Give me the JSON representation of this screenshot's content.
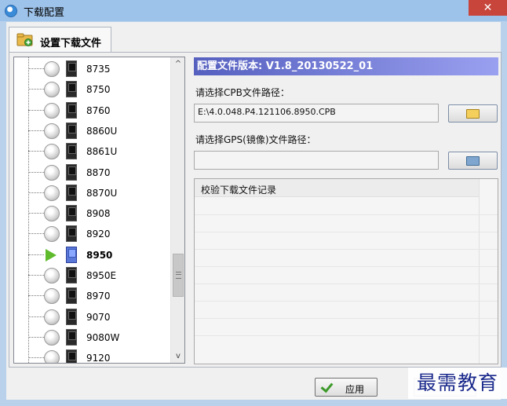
{
  "window": {
    "title": "下载配置",
    "close_glyph": "✕"
  },
  "tab": {
    "label": "设置下载文件",
    "icon": "folder-add-icon"
  },
  "tree": {
    "items": [
      {
        "label": "8735",
        "state": "idle"
      },
      {
        "label": "8750",
        "state": "idle"
      },
      {
        "label": "8760",
        "state": "idle"
      },
      {
        "label": "8860U",
        "state": "idle"
      },
      {
        "label": "8861U",
        "state": "idle"
      },
      {
        "label": "8870",
        "state": "idle"
      },
      {
        "label": "8870U",
        "state": "idle"
      },
      {
        "label": "8908",
        "state": "idle"
      },
      {
        "label": "8920",
        "state": "idle"
      },
      {
        "label": "8950",
        "state": "selected"
      },
      {
        "label": "8950E",
        "state": "idle"
      },
      {
        "label": "8970",
        "state": "idle"
      },
      {
        "label": "9070",
        "state": "idle"
      },
      {
        "label": "9080W",
        "state": "idle"
      },
      {
        "label": "9120",
        "state": "idle"
      }
    ],
    "scroll_up": "^",
    "scroll_down": "v",
    "scroll_position": 0.65
  },
  "config": {
    "version_text": "配置文件版本: V1.8_20130522_01",
    "cpb_label": "请选择CPB文件路径：",
    "cpb_value": "E:\\4.0.048.P4.121106.8950.CPB",
    "gps_label": "请选择GPS(镜像)文件路径：",
    "gps_value": ""
  },
  "log": {
    "title": "校验下载文件记录"
  },
  "footer": {
    "apply_label": "应用"
  },
  "watermark": {
    "text": "最需教育"
  },
  "colors": {
    "banner": "#6c74d6",
    "selected_play": "#5fba2c",
    "title_bar": "#9ec3ea",
    "close": "#c7453b"
  }
}
